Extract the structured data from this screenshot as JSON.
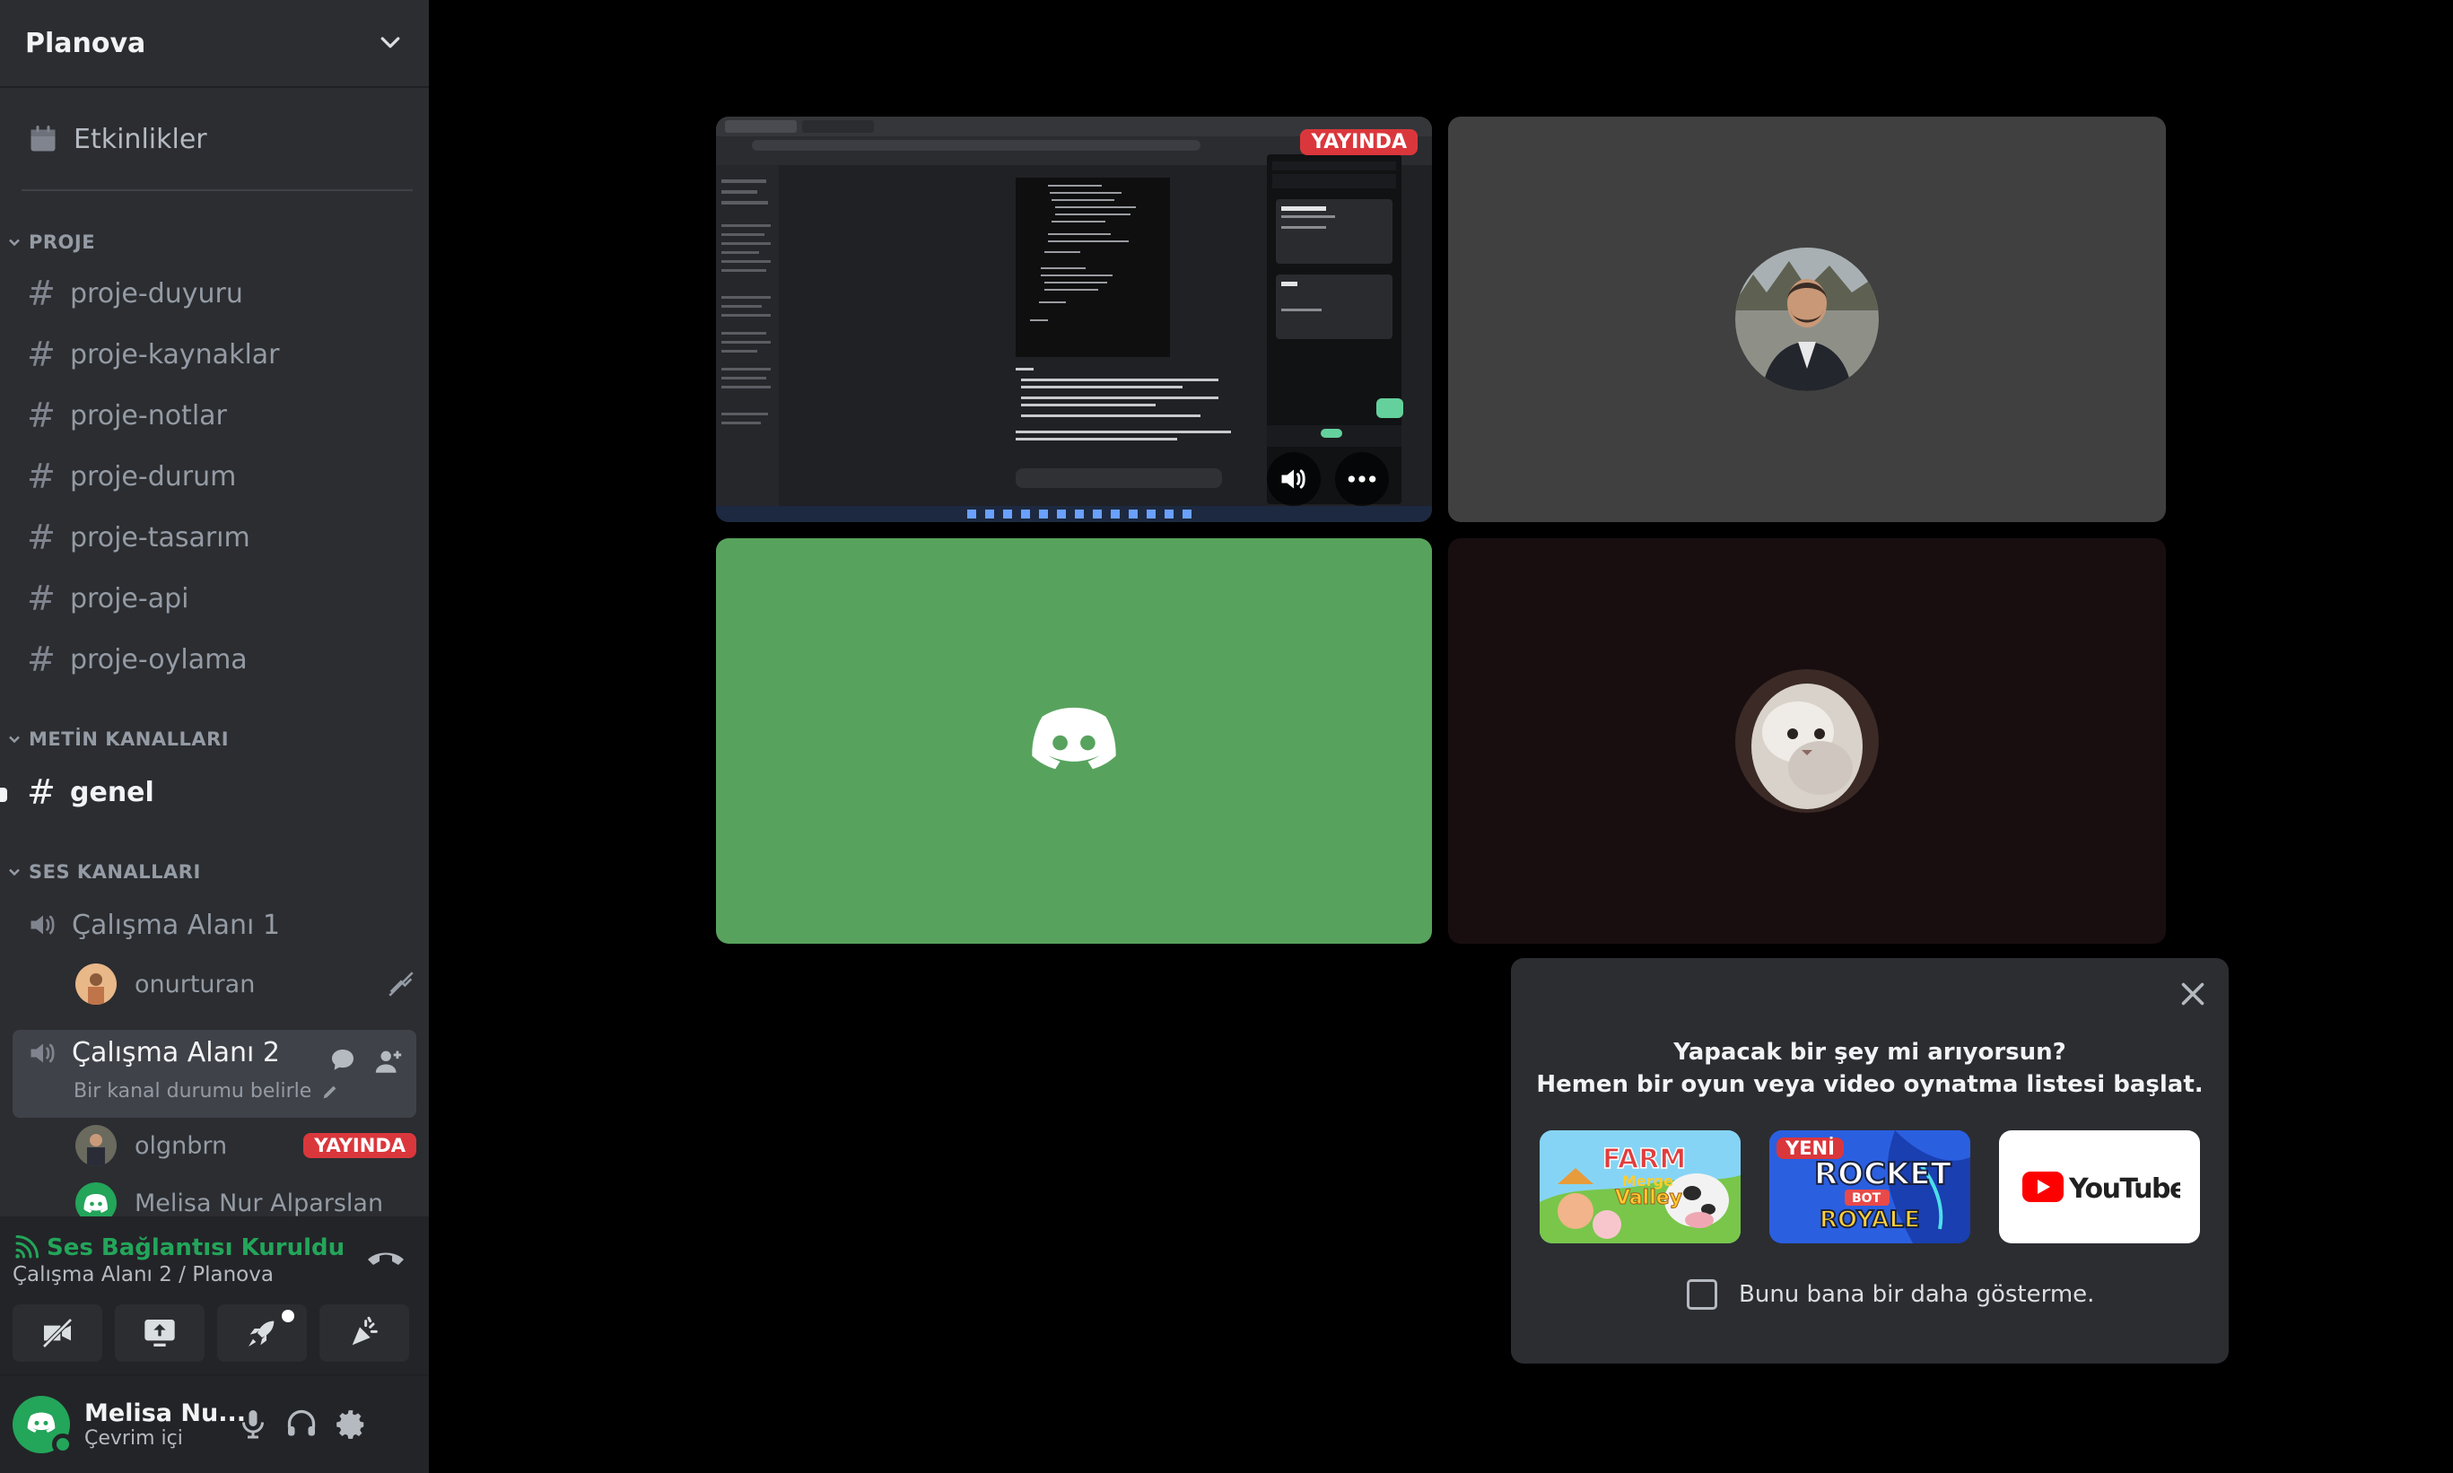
{
  "server": {
    "name": "Planova"
  },
  "events": {
    "label": "Etkinlikler"
  },
  "categories": {
    "proje": "PROJE",
    "metin": "METİN KANALLARI",
    "ses": "SES KANALLARI"
  },
  "project_channels": [
    "proje-duyuru",
    "proje-kaynaklar",
    "proje-notlar",
    "proje-durum",
    "proje-tasarım",
    "proje-api",
    "proje-oylama"
  ],
  "text_channels": [
    "genel"
  ],
  "voice_channels": [
    {
      "label": "Çalışma Alanı 1",
      "users": [
        {
          "name": "onurturan"
        }
      ]
    },
    {
      "label": "Çalışma Alanı 2",
      "status_placeholder": "Bir kanal durumu belirle",
      "users": [
        {
          "name": "olgnbrn",
          "badge": "YAYINDA"
        },
        {
          "name": "Melisa Nur Alparslan"
        }
      ]
    }
  ],
  "voice_connection": {
    "status": "Ses Bağlantısı Kuruldu",
    "location": "Çalışma Alanı 2 / Planova"
  },
  "user": {
    "display_name": "Melisa Nu...",
    "status": "Çevrim içi"
  },
  "stage": {
    "stream_badge": "YAYINDA"
  },
  "popup": {
    "line1": "Yapacak bir şey mi arıyorsun?",
    "line2": "Hemen bir oyun veya video oynatma listesi başlat.",
    "activities": [
      {
        "name": "Farm Merge Valley"
      },
      {
        "name": "Rocket Bot Royale",
        "badge": "YENİ"
      },
      {
        "name": "YouTube"
      }
    ],
    "dont_show": "Bunu bana bir daha gösterme."
  },
  "colors": {
    "accent_green": "#23a55a",
    "live_red": "#da373c",
    "sidebar_bg": "#2b2d31",
    "panel_bg": "#232428"
  }
}
